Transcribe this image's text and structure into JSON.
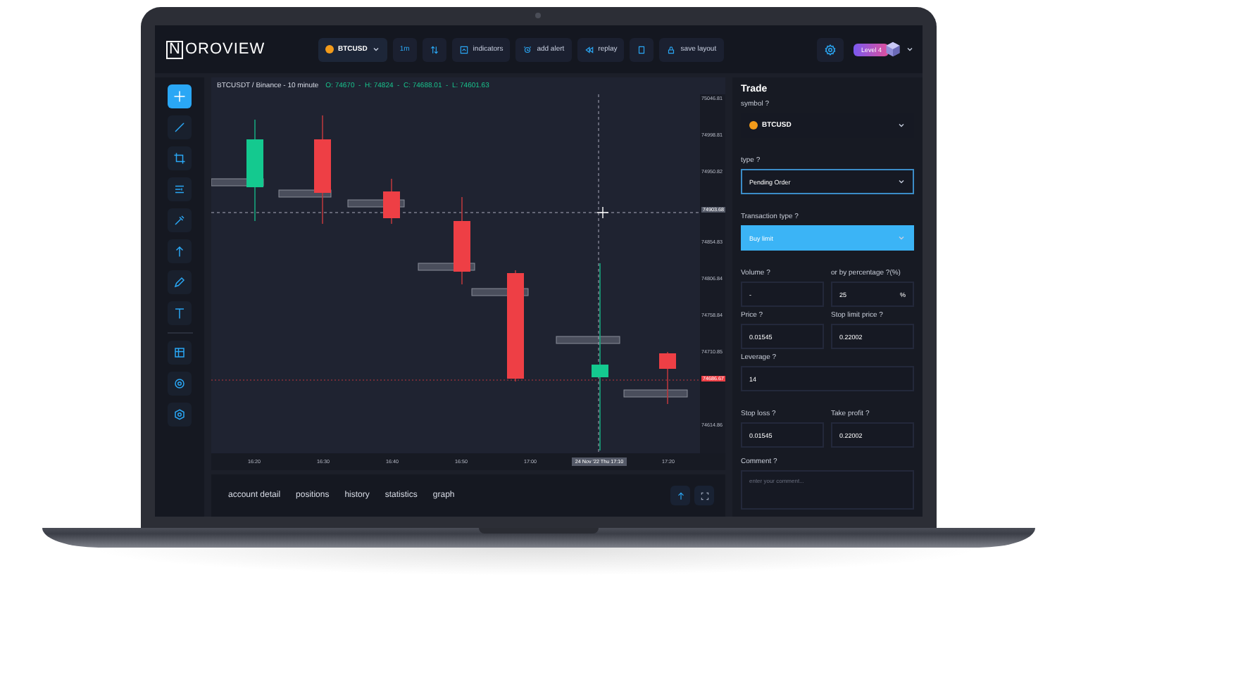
{
  "app": {
    "logo": "NOROVIEW"
  },
  "topbar": {
    "items": [
      {
        "kind": "symbol",
        "label": "BTCUSD"
      },
      {
        "kind": "text",
        "label": "1m"
      },
      {
        "kind": "icon"
      },
      {
        "kind": "icon-text",
        "label": "indicators"
      },
      {
        "kind": "icon-text",
        "label": "add alert"
      },
      {
        "kind": "icon-text",
        "label": "replay"
      },
      {
        "kind": "icon"
      },
      {
        "kind": "icon-text",
        "label": "save layout"
      }
    ],
    "level": "Level 4"
  },
  "tools": [
    {
      "selected": true
    },
    {
      "selected": false
    },
    {
      "selected": false
    },
    {
      "selected": false
    },
    {
      "selected": false
    },
    {
      "selected": false
    },
    {
      "selected": false
    },
    {
      "selected": false
    }
  ],
  "tools_extra": [
    {
      "selected": false
    },
    {
      "selected": false
    },
    {
      "selected": false
    }
  ],
  "chart": {
    "title": "BTCUSDT / Binance - 10 minute",
    "ohlc": "O: 74670  -  H: 74824  -  C: 74688.01  -  L: 74601.63",
    "price_axis": [
      {
        "label": "75046.81",
        "kind": "tick"
      },
      {
        "label": "74998.81",
        "kind": "tick"
      },
      {
        "label": "74950.82",
        "kind": "tick"
      },
      {
        "label": "74903.68",
        "kind": "cursor"
      },
      {
        "label": "74854.83",
        "kind": "tick"
      },
      {
        "label": "74806.84",
        "kind": "tick"
      },
      {
        "label": "74758.84",
        "kind": "tick"
      },
      {
        "label": "74710.85",
        "kind": "tick"
      },
      {
        "label": "74686.67",
        "kind": "current"
      },
      {
        "label": "74614.86",
        "kind": "tick"
      }
    ],
    "time_axis": [
      {
        "label": "16:20",
        "kind": "tick"
      },
      {
        "label": "16:30",
        "kind": "tick"
      },
      {
        "label": "16:40",
        "kind": "tick"
      },
      {
        "label": "16:50",
        "kind": "tick"
      },
      {
        "label": "17:00",
        "kind": "tick"
      },
      {
        "label": "24 Nov '22 Thu 17:10",
        "kind": "cursor"
      },
      {
        "label": "17:20",
        "kind": "tick"
      }
    ]
  },
  "bottom_tabs": [
    {
      "label": "account detail",
      "selected": false
    },
    {
      "label": "positions",
      "selected": false
    },
    {
      "label": "history",
      "selected": false
    },
    {
      "label": "statistics",
      "selected": false
    },
    {
      "label": "graph",
      "selected": false
    }
  ],
  "trade": {
    "title": "Trade",
    "rows": [
      {
        "kind": "symbol",
        "label": "symbol ?",
        "value": "BTCUSD",
        "focused": false
      },
      {
        "kind": "select",
        "label": "type ?",
        "value": "Pending Order",
        "focused": true
      },
      {
        "kind": "action",
        "label": "Transaction type ?",
        "value": "Buy limit",
        "focused": false
      },
      {
        "kind": "pair",
        "fields": [
          {
            "label": "Volume ?",
            "value": "-"
          },
          {
            "label": "or by percentage ?(%)",
            "value": "25",
            "suffix": "%"
          }
        ]
      },
      {
        "kind": "pair",
        "fields": [
          {
            "label": "Price ?",
            "value": "0.01545"
          },
          {
            "label": "Stop limit price ?",
            "value": "0.22002"
          }
        ]
      },
      {
        "kind": "input",
        "label": "Leverage ?",
        "value": "14"
      },
      {
        "kind": "pair",
        "fields": [
          {
            "label": "Stop loss ?",
            "value": "0.01545"
          },
          {
            "label": "Take profit ?",
            "value": "0.22002"
          }
        ]
      },
      {
        "kind": "textarea",
        "label": "Comment ?",
        "placeholder": "enter your comment..."
      }
    ]
  }
}
